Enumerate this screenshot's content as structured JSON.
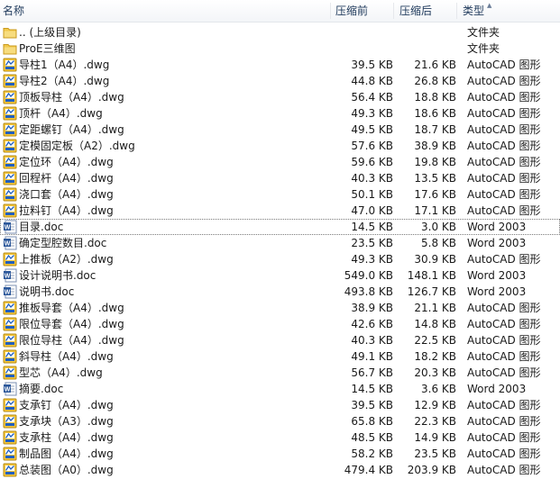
{
  "columns": {
    "name": "名称",
    "size": "压缩前",
    "packed": "压缩后",
    "type": "类型"
  },
  "icons": {
    "folder": "folder-icon",
    "dwg": "autocad-dwg-icon",
    "doc": "word-doc-icon"
  },
  "colors": {
    "folder": "#f2c94c",
    "dwg_frame": "#f3c53b",
    "dwg_accent": "#1f5fbf",
    "doc_blue": "#2b579a"
  },
  "rows": [
    {
      "name": ".. (上级目录)",
      "size": "",
      "packed": "",
      "type": "文件夹",
      "icon": "folder"
    },
    {
      "name": "ProE三维图",
      "size": "",
      "packed": "",
      "type": "文件夹",
      "icon": "folder"
    },
    {
      "name": "导柱1（A4）.dwg",
      "size": "39.5 KB",
      "packed": "21.6 KB",
      "type": "AutoCAD 图形",
      "icon": "dwg"
    },
    {
      "name": "导柱2（A4）.dwg",
      "size": "44.8 KB",
      "packed": "26.8 KB",
      "type": "AutoCAD 图形",
      "icon": "dwg"
    },
    {
      "name": "顶板导柱（A4）.dwg",
      "size": "56.4 KB",
      "packed": "18.8 KB",
      "type": "AutoCAD 图形",
      "icon": "dwg"
    },
    {
      "name": "顶杆（A4）.dwg",
      "size": "49.3 KB",
      "packed": "18.6 KB",
      "type": "AutoCAD 图形",
      "icon": "dwg"
    },
    {
      "name": "定距螺钉（A4）.dwg",
      "size": "49.5 KB",
      "packed": "18.7 KB",
      "type": "AutoCAD 图形",
      "icon": "dwg"
    },
    {
      "name": "定模固定板（A2）.dwg",
      "size": "57.6 KB",
      "packed": "38.9 KB",
      "type": "AutoCAD 图形",
      "icon": "dwg"
    },
    {
      "name": "定位环（A4）.dwg",
      "size": "59.6 KB",
      "packed": "19.8 KB",
      "type": "AutoCAD 图形",
      "icon": "dwg"
    },
    {
      "name": "回程杆（A4）.dwg",
      "size": "40.3 KB",
      "packed": "13.5 KB",
      "type": "AutoCAD 图形",
      "icon": "dwg"
    },
    {
      "name": "浇口套（A4）.dwg",
      "size": "50.1 KB",
      "packed": "17.6 KB",
      "type": "AutoCAD 图形",
      "icon": "dwg"
    },
    {
      "name": "拉料钉（A4）.dwg",
      "size": "47.0 KB",
      "packed": "17.1 KB",
      "type": "AutoCAD 图形",
      "icon": "dwg"
    },
    {
      "name": "目录.doc",
      "size": "14.5 KB",
      "packed": "3.0 KB",
      "type": "Word 2003",
      "icon": "doc"
    },
    {
      "name": "确定型腔数目.doc",
      "size": "23.5 KB",
      "packed": "5.8 KB",
      "type": "Word 2003",
      "icon": "doc"
    },
    {
      "name": "上推板（A2）.dwg",
      "size": "49.3 KB",
      "packed": "30.9 KB",
      "type": "AutoCAD 图形",
      "icon": "dwg"
    },
    {
      "name": "设计说明书.doc",
      "size": "549.0 KB",
      "packed": "148.1 KB",
      "type": "Word 2003",
      "icon": "doc"
    },
    {
      "name": "说明书.doc",
      "size": "493.8 KB",
      "packed": "126.7 KB",
      "type": "Word 2003",
      "icon": "doc"
    },
    {
      "name": "推板导套（A4）.dwg",
      "size": "38.9 KB",
      "packed": "21.1 KB",
      "type": "AutoCAD 图形",
      "icon": "dwg"
    },
    {
      "name": "限位导套（A4）.dwg",
      "size": "42.6 KB",
      "packed": "14.8 KB",
      "type": "AutoCAD 图形",
      "icon": "dwg"
    },
    {
      "name": "限位导柱（A4）.dwg",
      "size": "40.3 KB",
      "packed": "22.5 KB",
      "type": "AutoCAD 图形",
      "icon": "dwg"
    },
    {
      "name": "斜导柱（A4）.dwg",
      "size": "49.1 KB",
      "packed": "18.2 KB",
      "type": "AutoCAD 图形",
      "icon": "dwg"
    },
    {
      "name": "型芯（A4）.dwg",
      "size": "56.7 KB",
      "packed": "20.3 KB",
      "type": "AutoCAD 图形",
      "icon": "dwg"
    },
    {
      "name": "摘要.doc",
      "size": "14.5 KB",
      "packed": "3.6 KB",
      "type": "Word 2003",
      "icon": "doc"
    },
    {
      "name": "支承钉（A4）.dwg",
      "size": "39.5 KB",
      "packed": "12.9 KB",
      "type": "AutoCAD 图形",
      "icon": "dwg"
    },
    {
      "name": "支承块（A3）.dwg",
      "size": "65.8 KB",
      "packed": "22.3 KB",
      "type": "AutoCAD 图形",
      "icon": "dwg"
    },
    {
      "name": "支承柱（A4）.dwg",
      "size": "48.5 KB",
      "packed": "14.9 KB",
      "type": "AutoCAD 图形",
      "icon": "dwg"
    },
    {
      "name": "制品图（A4）.dwg",
      "size": "58.2 KB",
      "packed": "23.5 KB",
      "type": "AutoCAD 图形",
      "icon": "dwg"
    },
    {
      "name": "总装图（A0）.dwg",
      "size": "479.4 KB",
      "packed": "203.9 KB",
      "type": "AutoCAD 图形",
      "icon": "dwg"
    }
  ]
}
